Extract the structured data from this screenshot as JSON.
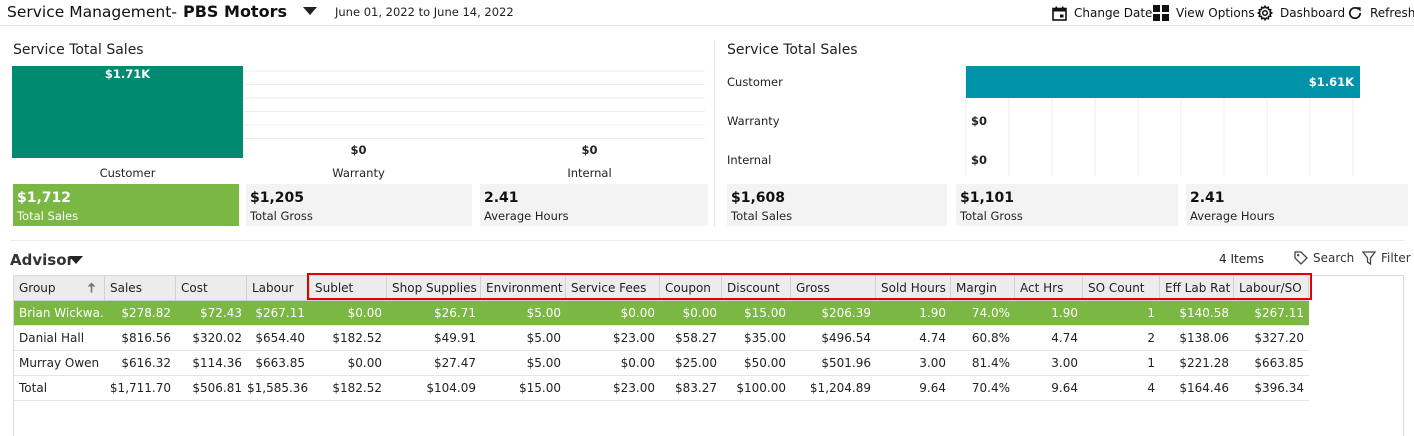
{
  "header": {
    "title": "Service Management-",
    "dealer": "PBS Motors",
    "date_range": "June 01, 2022 to June 14, 2022",
    "tools": {
      "change_date": "Change Date",
      "view_options": "View Options",
      "dashboard": "Dashboard",
      "refresh": "Refresh"
    }
  },
  "colors": {
    "teal": "#008a70",
    "blue": "#0092a8",
    "green": "#7ab743"
  },
  "left_panel": {
    "title": "Service Total Sales",
    "chart_data": {
      "type": "bar",
      "categories": [
        "Customer",
        "Warranty",
        "Internal"
      ],
      "values": [
        1710,
        0,
        0
      ],
      "data_labels": [
        "$1.71K",
        "$0",
        "$0"
      ],
      "orientation": "vertical",
      "grid": true
    },
    "kpis": [
      {
        "value": "$1,712",
        "label": "Total Sales"
      },
      {
        "value": "$1,205",
        "label": "Total Gross"
      },
      {
        "value": "2.41",
        "label": "Average Hours"
      }
    ]
  },
  "right_panel": {
    "title": "Service Total Sales",
    "chart_data": {
      "type": "bar",
      "categories": [
        "Customer",
        "Warranty",
        "Internal"
      ],
      "values": [
        1610,
        0,
        0
      ],
      "data_labels": [
        "$1.61K",
        "$0",
        "$0"
      ],
      "orientation": "horizontal",
      "grid": true
    },
    "kpis": [
      {
        "value": "$1,608",
        "label": "Total Sales"
      },
      {
        "value": "$1,101",
        "label": "Total Gross"
      },
      {
        "value": "2.41",
        "label": "Average Hours"
      }
    ]
  },
  "advisor": {
    "title": "Advisor",
    "count": "4 Items",
    "search": "Search",
    "filter": "Filter",
    "columns": [
      "Group",
      "Sales",
      "Cost",
      "Labour",
      "Sublet",
      "Shop Supplies",
      "Environment",
      "Service Fees",
      "Coupon",
      "Discount",
      "Gross",
      "Sold Hours",
      "Margin",
      "Act Hrs",
      "SO Count",
      "Eff Lab Rat",
      "Labour/SO"
    ],
    "rows": [
      [
        "Brian Wickwa...",
        "$278.82",
        "$72.43",
        "$267.11",
        "$0.00",
        "$26.71",
        "$5.00",
        "$0.00",
        "$0.00",
        "$15.00",
        "$206.39",
        "1.90",
        "74.0%",
        "1.90",
        "1",
        "$140.58",
        "$267.11"
      ],
      [
        "Danial Hall",
        "$816.56",
        "$320.02",
        "$654.40",
        "$182.52",
        "$49.91",
        "$5.00",
        "$23.00",
        "$58.27",
        "$35.00",
        "$496.54",
        "4.74",
        "60.8%",
        "4.74",
        "2",
        "$138.06",
        "$327.20"
      ],
      [
        "Murray Owen",
        "$616.32",
        "$114.36",
        "$663.85",
        "$0.00",
        "$27.47",
        "$5.00",
        "$0.00",
        "$25.00",
        "$50.00",
        "$501.96",
        "3.00",
        "81.4%",
        "3.00",
        "1",
        "$221.28",
        "$663.85"
      ],
      [
        "Total",
        "$1,711.70",
        "$506.81",
        "$1,585.36",
        "$182.52",
        "$104.09",
        "$15.00",
        "$23.00",
        "$83.27",
        "$100.00",
        "$1,204.89",
        "9.64",
        "70.4%",
        "9.64",
        "4",
        "$164.46",
        "$396.34"
      ]
    ]
  }
}
